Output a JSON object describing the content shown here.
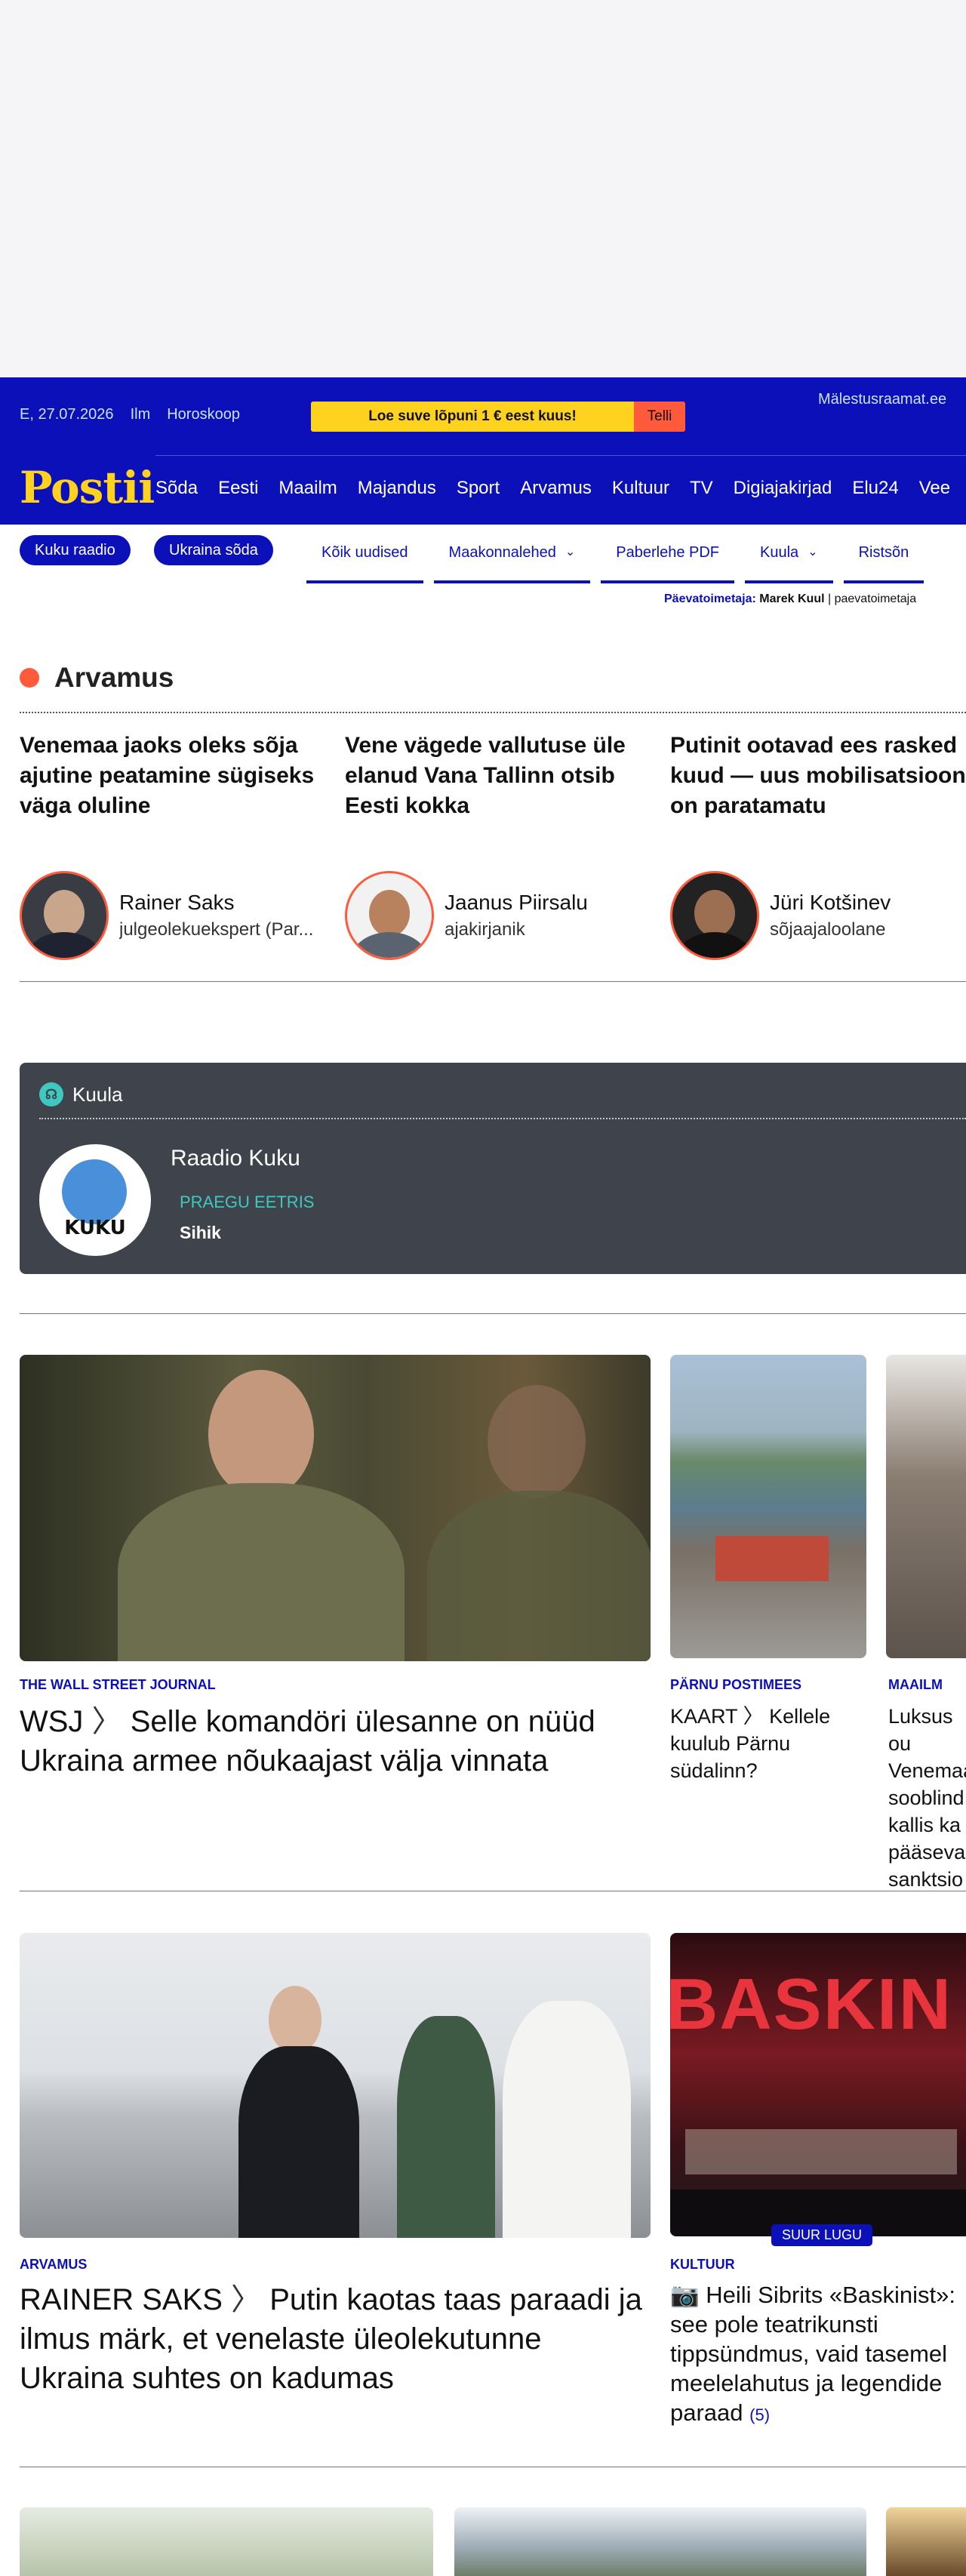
{
  "topbar": {
    "date": "E, 27.07.2026",
    "weather": "Ilm",
    "horoscope": "Horoskoop",
    "promo_text": "Loe suve lõpuni 1 € eest kuus!",
    "promo_button": "Telli",
    "malestus": "Mälestusraamat.ee"
  },
  "logo": "Postii",
  "nav": [
    "Sõda",
    "Eesti",
    "Maailm",
    "Majandus",
    "Sport",
    "Arvamus",
    "Kultuur",
    "TV",
    "Digiajakirjad",
    "Elu24",
    "Vee"
  ],
  "pills": [
    "Kuku raadio",
    "Ukraina sõda"
  ],
  "tabs": [
    "Kõik uudised",
    "Maakonnalehed",
    "Paberlehe PDF",
    "Kuula",
    "Ristsõn"
  ],
  "editor": {
    "label": "Päevatoimetaja:",
    "name": "Marek Kuul",
    "email": "paevatoimetaja"
  },
  "opinion": {
    "title": "Arvamus",
    "items": [
      {
        "title": "Venemaa jaoks oleks sõja ajutine peatamine sügiseks väga oluline",
        "author": "Rainer Saks",
        "role": "julgeolekuekspert (Par..."
      },
      {
        "title": "Vene vägede vallutuse üle elanud Vana Tallinn otsib Eesti kokka",
        "author": "Jaanus Piirsalu",
        "role": "ajakirjanik"
      },
      {
        "title": "Putinit ootavad ees rasked kuud — uus mobilisatsioon on paratamatu",
        "author": "Jüri Kotšinev",
        "role": "sõjaajaloolane"
      }
    ]
  },
  "kuula": {
    "title": "Kuula",
    "station": "Raadio Kuku",
    "logo_word": "KUKU",
    "live_label": "PRAEGU EETRIS",
    "show": "Sihik"
  },
  "articles": {
    "a1": {
      "kicker": "The Wall Street Journal",
      "prefix": "WSJ",
      "title": "Selle komandöri ülesanne on nüüd Ukraina armee nõukaajast välja vinnata"
    },
    "a2": {
      "kicker": "Pärnu Postimees",
      "prefix": "KAART",
      "title": "Kellele kuulub Pärnu südalinn?"
    },
    "a3": {
      "kicker": "Maailm",
      "title": "Luksus ou Venemaa sooblind kallis ka pääseva sanktsio"
    },
    "a4": {
      "kicker": "Arvamus",
      "prefix": "RAINER SAKS",
      "title": "Putin kaotas taas paraadi ja ilmus märk, et venelaste üleolekutunne Ukraina suhtes on kadumas"
    },
    "a5": {
      "kicker": "Kultuur",
      "badge": "SUUR LUGU",
      "title": "Heili Sibrits «Baskinist»: see pole teatrikunsti tippsündmus, vaid tasemel meelelahutus ja legendide paraad",
      "count": "(5)",
      "image_text": "BASKIN"
    }
  },
  "colors": {
    "brand": "#0c10b8",
    "accent": "#ff5a3c",
    "promo": "#ffd21f",
    "kuula_bg": "#3f434c",
    "kuula_accent": "#3fc8c0"
  }
}
